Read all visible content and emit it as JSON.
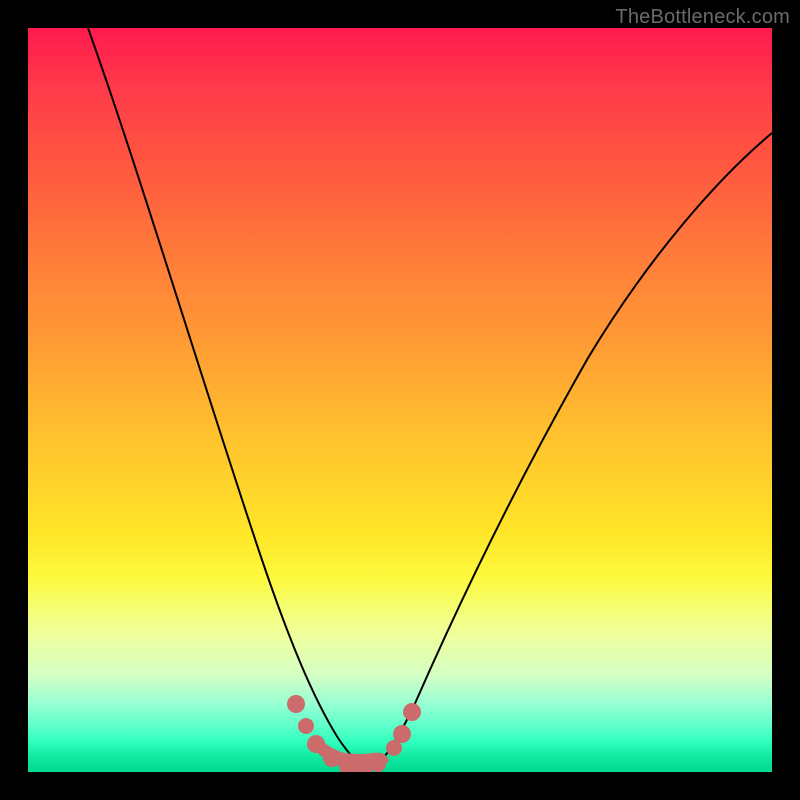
{
  "watermark": "TheBottleneck.com",
  "chart_data": {
    "type": "line",
    "title": "",
    "xlabel": "",
    "ylabel": "",
    "xlim": [
      0,
      100
    ],
    "ylim": [
      0,
      100
    ],
    "grid": false,
    "legend": false,
    "series": [
      {
        "name": "bottleneck-curve",
        "x": [
          10,
          15,
          20,
          25,
          28,
          30,
          32,
          34,
          36,
          38,
          40,
          42,
          44,
          46,
          48,
          50,
          55,
          60,
          65,
          70,
          75,
          80,
          85,
          90,
          95,
          100
        ],
        "y": [
          100,
          82,
          65,
          48,
          38,
          30,
          22,
          15,
          9,
          5,
          2,
          1,
          0,
          0,
          1,
          3,
          8,
          15,
          23,
          32,
          41,
          50,
          57,
          63,
          68,
          72
        ]
      }
    ],
    "markers": {
      "name": "highlighted-points",
      "color": "#cc6b6b",
      "points": [
        {
          "x": 36,
          "y": 9
        },
        {
          "x": 38,
          "y": 5
        },
        {
          "x": 40,
          "y": 2
        },
        {
          "x": 42,
          "y": 1
        },
        {
          "x": 44,
          "y": 0
        },
        {
          "x": 46,
          "y": 0
        },
        {
          "x": 47,
          "y": 1
        },
        {
          "x": 49,
          "y": 3
        },
        {
          "x": 50,
          "y": 4
        },
        {
          "x": 52,
          "y": 6
        }
      ]
    },
    "background_gradient": {
      "top": "#ff1a4d",
      "mid": "#ffe628",
      "bottom": "#00d98e"
    }
  }
}
